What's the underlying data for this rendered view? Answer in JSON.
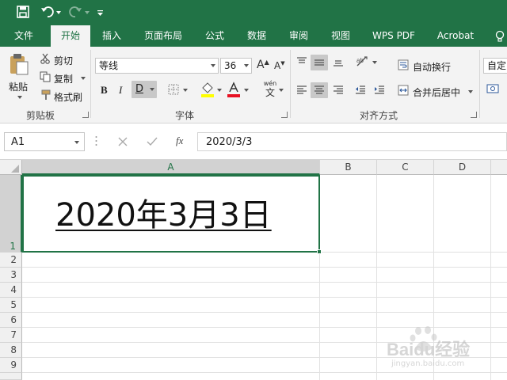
{
  "tabs": [
    "文件",
    "开始",
    "插入",
    "页面布局",
    "公式",
    "数据",
    "审阅",
    "视图",
    "WPS PDF",
    "Acrobat"
  ],
  "ribbon": {
    "paste_label": "粘贴",
    "cut_label": "剪切",
    "copy_label": "复制",
    "format_painter_label": "格式刷",
    "clipboard_group": "剪贴板",
    "font_name": "等线",
    "font_size": "36",
    "font_group": "字体",
    "bold": "B",
    "italic": "I",
    "underline": "D",
    "wrap_text_label": "自动换行",
    "merge_center_label": "合并后居中",
    "alignment_group": "对齐方式",
    "number_format": "自定义",
    "wen_label": "wén",
    "wen_char": "文"
  },
  "formula_bar": {
    "name_box": "A1",
    "fx": "fx",
    "formula_value": "2020/3/3"
  },
  "sheet": {
    "columns": [
      "A",
      "B",
      "C",
      "D"
    ],
    "rows": [
      "1",
      "2",
      "3",
      "4",
      "5",
      "6",
      "7",
      "8",
      "9"
    ],
    "cell_a1": "2020年3月3日"
  },
  "watermark": {
    "brand": "Baidu经验",
    "url": "jingyan.baidu.com"
  },
  "colors": {
    "excel_green": "#217346",
    "ribbon_bg": "#f3f3f3"
  }
}
